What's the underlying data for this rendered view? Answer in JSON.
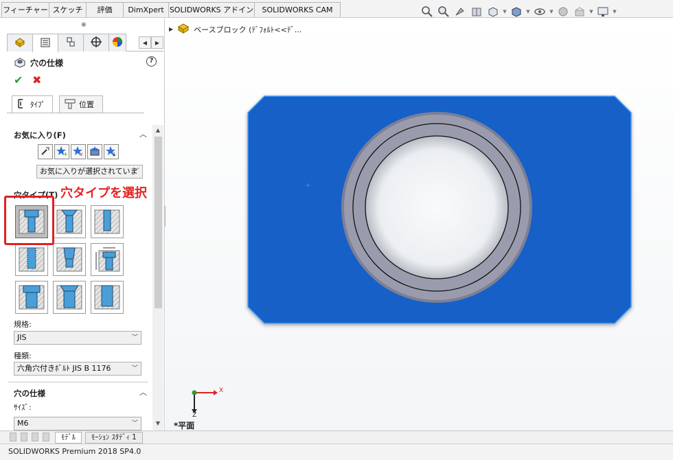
{
  "command_tabs": [
    "フィーチャー",
    "スケッチ",
    "評価",
    "DimXpert",
    "SOLIDWORKS アドイン",
    "SOLIDWORKS CAM"
  ],
  "view_toolbar": [
    "zoom-to-fit-icon",
    "zoom-area-icon",
    "previous-view-icon",
    "section-view-icon",
    "view-orientation-icon",
    "display-style-icon",
    "hide-show-items-icon",
    "edit-appearance-icon",
    "apply-scene-icon",
    "view-settings-icon"
  ],
  "property_manager": {
    "tabs": [
      "feature-manager-icon",
      "property-manager-icon",
      "configuration-manager-icon",
      "dimxpert-manager-icon",
      "display-manager-icon"
    ],
    "title": "穴の仕様",
    "subtabs": [
      "ﾀｲﾌﾟ",
      "位置"
    ],
    "favorites": {
      "header": "お気に入り(F)",
      "combo_value": "お気に入りが選択されていま"
    },
    "hole_type": {
      "header": "穴タイプ(T)",
      "selected_index": 0,
      "callout": "穴タイプを選択"
    },
    "standard": {
      "label": "規格:",
      "value": "JIS"
    },
    "type": {
      "label": "種類:",
      "value": "六角穴付きﾎﾞﾙﾄ JIS B 1176"
    },
    "hole_spec": {
      "header": "穴の仕様",
      "size_label": "ｻｲｽﾞ:",
      "size_value": "M6"
    }
  },
  "graphics": {
    "tree_label": "ベースブロック  (ﾃﾞﾌｫﾙﾄ<<ﾃﾞ...",
    "triad": {
      "x": "X",
      "z": "Z"
    },
    "view_name": "*平面",
    "colors": {
      "part_face": "#1560c8",
      "hole_ring": "#9a9cae"
    }
  },
  "bottom_tabs": [
    "ﾓﾃﾞﾙ",
    "ﾓｰｼｮﾝ ｽﾀﾃﾞｨ 1"
  ],
  "status": "SOLIDWORKS Premium 2018 SP4.0"
}
